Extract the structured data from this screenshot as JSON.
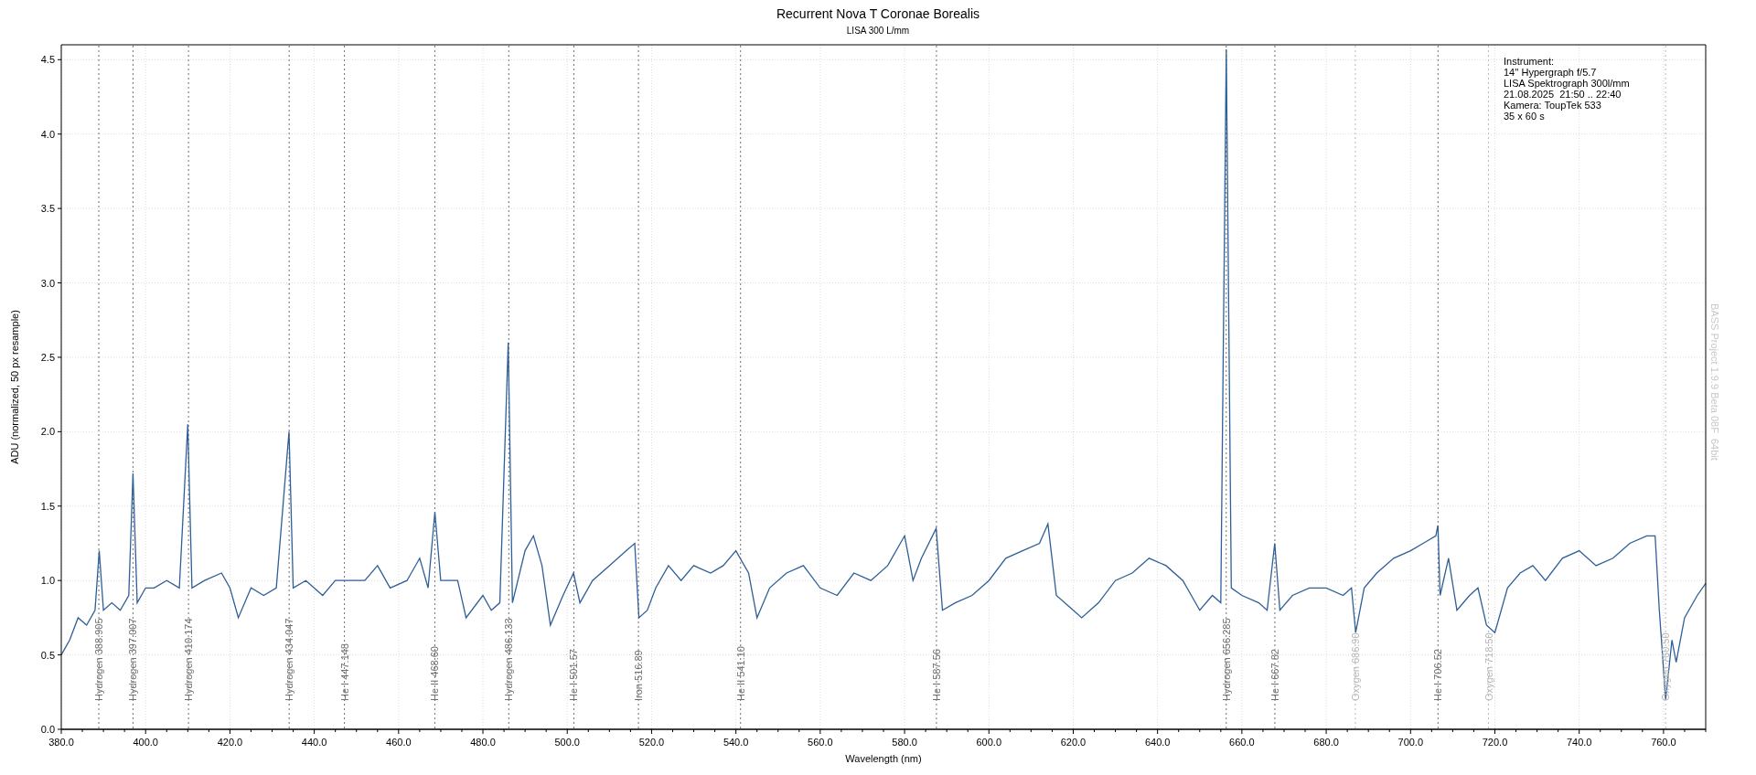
{
  "chart_data": {
    "type": "line",
    "title": "Recurrent Nova T Coronae Borealis",
    "xlabel": "Wavelength (nm)",
    "ylabel": "ADU (normalized, 50 px resample)",
    "x": [
      380,
      382,
      384,
      386,
      388,
      389,
      390,
      392,
      394,
      396,
      397,
      398,
      400,
      402,
      405,
      408,
      410,
      411,
      414,
      418,
      420,
      422,
      425,
      428,
      431,
      434,
      435,
      438,
      442,
      445,
      448,
      452,
      455,
      458,
      462,
      465,
      467,
      468.6,
      470,
      474,
      476,
      480,
      482,
      484,
      486,
      487,
      490,
      492,
      494,
      496,
      499,
      501.5,
      503,
      506,
      510,
      514,
      516,
      517,
      519,
      521,
      524,
      527,
      530,
      534,
      537,
      540,
      543,
      545,
      548,
      552,
      556,
      560,
      564,
      568,
      572,
      576,
      580,
      582,
      584,
      587.5,
      589,
      592,
      596,
      600,
      604,
      608,
      612,
      614,
      616,
      620,
      622,
      626,
      630,
      634,
      638,
      642,
      646,
      650,
      653,
      655,
      656.3,
      657.5,
      660,
      664,
      666,
      667.8,
      669,
      672,
      676,
      680,
      684,
      686,
      687,
      689,
      692,
      696,
      700,
      703,
      706,
      706.5,
      707,
      709,
      711,
      714,
      716,
      718,
      720,
      723,
      726,
      729,
      732,
      736,
      740,
      744,
      748,
      752,
      756,
      758,
      759,
      760.5,
      762,
      763,
      765,
      768,
      770
    ],
    "series": [
      {
        "color": "#2f5f97",
        "values": [
          0.5,
          0.6,
          0.75,
          0.7,
          0.8,
          1.2,
          0.8,
          0.85,
          0.8,
          0.9,
          1.72,
          0.85,
          0.95,
          0.95,
          1.0,
          0.95,
          2.05,
          0.95,
          1.0,
          1.05,
          0.95,
          0.75,
          0.95,
          0.9,
          0.95,
          2.0,
          0.95,
          1.0,
          0.9,
          1.0,
          1.0,
          1.0,
          1.1,
          0.95,
          1.0,
          1.15,
          0.95,
          1.46,
          1.0,
          1.0,
          0.75,
          0.9,
          0.8,
          0.85,
          2.6,
          0.85,
          1.2,
          1.3,
          1.1,
          0.7,
          0.9,
          1.05,
          0.85,
          1.0,
          1.1,
          1.2,
          1.25,
          0.75,
          0.8,
          0.95,
          1.1,
          1.0,
          1.1,
          1.05,
          1.1,
          1.2,
          1.05,
          0.75,
          0.95,
          1.05,
          1.1,
          0.95,
          0.9,
          1.05,
          1.0,
          1.1,
          1.3,
          1.0,
          1.15,
          1.35,
          0.8,
          0.85,
          0.9,
          1.0,
          1.15,
          1.2,
          1.25,
          1.38,
          0.9,
          0.8,
          0.75,
          0.85,
          1.0,
          1.05,
          1.15,
          1.1,
          1.0,
          0.8,
          0.9,
          0.85,
          4.57,
          0.95,
          0.9,
          0.85,
          0.8,
          1.25,
          0.8,
          0.9,
          0.95,
          0.95,
          0.9,
          0.95,
          0.65,
          0.95,
          1.05,
          1.15,
          1.2,
          1.25,
          1.3,
          1.37,
          0.9,
          1.15,
          0.8,
          0.9,
          0.95,
          0.7,
          0.65,
          0.95,
          1.05,
          1.1,
          1.0,
          1.15,
          1.2,
          1.1,
          1.15,
          1.25,
          1.3,
          1.3,
          0.8,
          0.2,
          0.6,
          0.45,
          0.75,
          0.9,
          0.98
        ]
      }
    ],
    "xlim": [
      380,
      770
    ],
    "ylim": [
      0,
      4.6
    ],
    "grid": true,
    "xticks": [
      {
        "value": 380,
        "label": "380.0"
      },
      {
        "value": 400,
        "label": "400.0"
      },
      {
        "value": 420,
        "label": "420.0"
      },
      {
        "value": 440,
        "label": "440.0"
      },
      {
        "value": 460,
        "label": "460.0"
      },
      {
        "value": 480,
        "label": "480.0"
      },
      {
        "value": 500,
        "label": "500.0"
      },
      {
        "value": 520,
        "label": "520.0"
      },
      {
        "value": 540,
        "label": "540.0"
      },
      {
        "value": 560,
        "label": "560.0"
      },
      {
        "value": 580,
        "label": "580.0"
      },
      {
        "value": 600,
        "label": "600.0"
      },
      {
        "value": 620,
        "label": "620.0"
      },
      {
        "value": 640,
        "label": "640.0"
      },
      {
        "value": 660,
        "label": "660.0"
      },
      {
        "value": 680,
        "label": "680.0"
      },
      {
        "value": 700,
        "label": "700.0"
      },
      {
        "value": 720,
        "label": "720.0"
      },
      {
        "value": 740,
        "label": "740.0"
      },
      {
        "value": 760,
        "label": "760.0"
      }
    ],
    "yticks": [
      {
        "value": 0,
        "label": "0.0"
      },
      {
        "value": 0.5,
        "label": "0.5"
      },
      {
        "value": 1,
        "label": "1.0"
      },
      {
        "value": 1.5,
        "label": "1.5"
      },
      {
        "value": 2,
        "label": "2.0"
      },
      {
        "value": 2.5,
        "label": "2.5"
      },
      {
        "value": 3,
        "label": "3.0"
      },
      {
        "value": 3.5,
        "label": "3.5"
      },
      {
        "value": 4,
        "label": "4.0"
      },
      {
        "value": 4.5,
        "label": "4.5"
      }
    ]
  },
  "spectral_lines": [
    {
      "element": "Hydrogen",
      "wavelength": "388.905",
      "color": "#707070"
    },
    {
      "element": "Hydrogen",
      "wavelength": "397.007",
      "color": "#707070"
    },
    {
      "element": "Hydrogen",
      "wavelength": "410.174",
      "color": "#707070"
    },
    {
      "element": "Hydrogen",
      "wavelength": "434.047",
      "color": "#707070"
    },
    {
      "element": "He I",
      "wavelength": "447.148",
      "color": "#707070"
    },
    {
      "element": "He II",
      "wavelength": "468.60",
      "color": "#707070"
    },
    {
      "element": "Hydrogen",
      "wavelength": "486.133",
      "color": "#707070"
    },
    {
      "element": "He I",
      "wavelength": "501.57",
      "color": "#707070"
    },
    {
      "element": "Iron",
      "wavelength": "516.89",
      "color": "#707070"
    },
    {
      "element": "He II",
      "wavelength": "541.10",
      "color": "#707070"
    },
    {
      "element": "He I",
      "wavelength": "587.56",
      "color": "#707070"
    },
    {
      "element": "Hydrogen",
      "wavelength": "656.285",
      "color": "#707070"
    },
    {
      "element": "He I",
      "wavelength": "667.82",
      "color": "#707070"
    },
    {
      "element": "Oxygen",
      "wavelength": "686.90",
      "color": "#b8b8b8"
    },
    {
      "element": "He I",
      "wavelength": "706.52",
      "color": "#707070"
    },
    {
      "element": "Oxygen",
      "wavelength": "718.50",
      "color": "#b8b8b8"
    },
    {
      "element": "Oxygen",
      "wavelength": "760.50",
      "color": "#b8b8b8"
    }
  ],
  "subtitle": "LISA 300 L/mm",
  "instrument_info": [
    "Instrument:",
    "14'' Hypergraph f/5.7",
    "LISA Spektrograph 300l/mm",
    "21.08.2025  21:50 .. 22:40",
    "Kamera: ToupTek 533",
    "35 x 60 s"
  ],
  "credit": "BASS Project 1.9.9 Beta 08F  64bit"
}
